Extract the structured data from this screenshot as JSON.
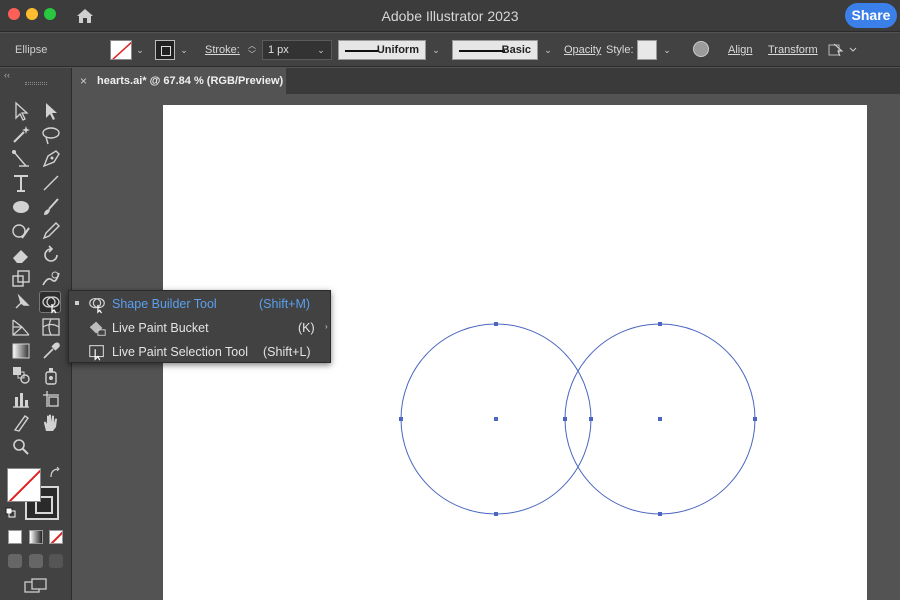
{
  "window": {
    "app_title": "Adobe Illustrator 2023",
    "share_label": "Share"
  },
  "control_bar": {
    "selection_name": "Ellipse",
    "stroke_label": "Stroke:",
    "stroke_weight": "1 px",
    "variable_width_profile": "Uniform",
    "brush_definition": "Basic",
    "opacity_label": "Opacity",
    "style_label": "Style:",
    "align_label": "Align",
    "transform_label": "Transform"
  },
  "document_tab": {
    "close_glyph": "×",
    "title": "hearts.ai* @ 67.84 % (RGB/Preview)"
  },
  "toolbar": {
    "collapse_glyph": "‹‹"
  },
  "flyout": {
    "items": [
      {
        "label": "Shape Builder Tool",
        "shortcut": "(Shift+M)",
        "icon": "shape-builder-icon",
        "selected": true
      },
      {
        "label": "Live Paint Bucket",
        "shortcut": "(K)",
        "icon": "live-paint-bucket-icon",
        "selected": false
      },
      {
        "label": "Live Paint Selection Tool",
        "shortcut": "(Shift+L)",
        "icon": "live-paint-selection-icon",
        "selected": false
      }
    ]
  },
  "colors": {
    "selection_blue": "#4a66c0",
    "highlight_text": "#5aa0ee",
    "share_button": "#3b7fe9"
  }
}
